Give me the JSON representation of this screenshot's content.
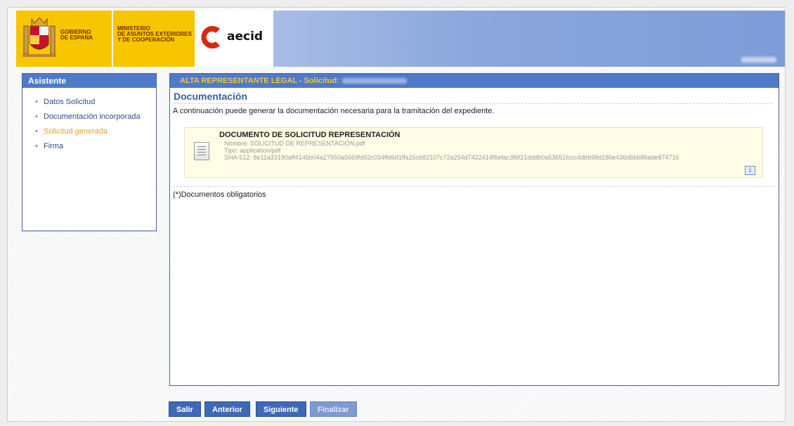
{
  "header": {
    "gobierno_line1": "GOBIERNO",
    "gobierno_line2": "DE ESPAÑA",
    "ministerio_line1": "MINISTERIO",
    "ministerio_line2": "DE ASUNTOS EXTERIORES",
    "ministerio_line3": "Y DE COOPERACIÓN",
    "aecid_logo_text": "aecid",
    "colors": {
      "gov_yellow": "#f7c600",
      "banner_blue": "#7e9cd8",
      "aecid_red": "#d62a10"
    }
  },
  "sidebar": {
    "title": "Asistente",
    "items": [
      {
        "label": "Datos Solicitud",
        "active": false
      },
      {
        "label": "Documentación incorporada",
        "active": false
      },
      {
        "label": "Solicitud generada",
        "active": true
      },
      {
        "label": "Firma",
        "active": false
      }
    ]
  },
  "panel": {
    "title": "ALTA REPRESENTANTE LEGAL - Solicitud:",
    "section_title": "Documentación",
    "section_desc": "A continuación puede generar la documentación necesaria para la tramitación del expediente.",
    "document": {
      "title": "DOCUMENTO DE SOLICITUD REPRESENTACIÓN",
      "nombre": "Nombre: SOLICITUD DE REPRESENTACIÓN.pdf",
      "tipo": "Tipo: application/pdf",
      "sha": "SHA-512: 8e11a33190aff4145b04a27950a5669fd92c034ffd6d1ffa15cb82107c72a294d7422414f6efac3f6f21dddb0a53651fccc4dbb98d180e436d66b86ade874716",
      "icon": "document-icon",
      "action_icon": "generate-doc-icon"
    },
    "note": "(*)Documentos obligatorios"
  },
  "buttons": {
    "salir": "Salir",
    "anterior": "Anterior",
    "siguiente": "Siguiente",
    "finalizar": "Finalizar"
  }
}
